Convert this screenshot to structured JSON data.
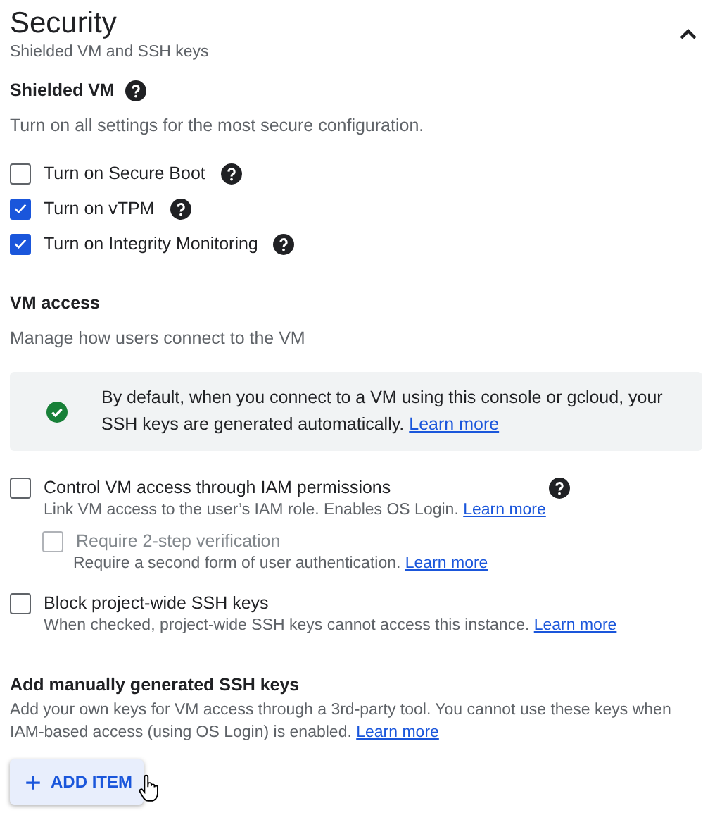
{
  "header": {
    "title": "Security",
    "subtitle": "Shielded VM and SSH keys",
    "expanded": true
  },
  "shielded_vm": {
    "heading": "Shielded VM",
    "help": true,
    "description": "Turn on all settings for the most secure configuration.",
    "options": [
      {
        "label": "Turn on Secure Boot",
        "checked": false,
        "help": true
      },
      {
        "label": "Turn on vTPM",
        "checked": true,
        "help": true
      },
      {
        "label": "Turn on Integrity Monitoring",
        "checked": true,
        "help": true
      }
    ]
  },
  "vm_access": {
    "heading": "VM access",
    "description": "Manage how users connect to the VM",
    "notice": {
      "text": "By default, when you connect to a VM using this console or gcloud, your SSH keys are generated automatically.",
      "link": "Learn more"
    },
    "options": [
      {
        "label": "Control VM access through IAM permissions",
        "description": "Link VM access to the user’s IAM role. Enables OS Login.",
        "link": "Learn more",
        "checked": false,
        "disabled": false,
        "help": true,
        "children": [
          {
            "label": "Require 2-step verification",
            "description": "Require a second form of user authentication.",
            "link": "Learn more",
            "checked": false,
            "disabled": true,
            "help": false
          }
        ]
      },
      {
        "label": "Block project-wide SSH keys",
        "description": "When checked, project-wide SSH keys cannot access this instance.",
        "link": "Learn more",
        "checked": false,
        "disabled": false,
        "help": false
      }
    ]
  },
  "manual_keys": {
    "heading": "Add manually generated SSH keys",
    "description": "Add your own keys for VM access through a 3rd-party tool. You cannot use these keys when IAM-based access (using OS Login) is enabled.",
    "link": "Learn more",
    "button": "ADD ITEM"
  }
}
